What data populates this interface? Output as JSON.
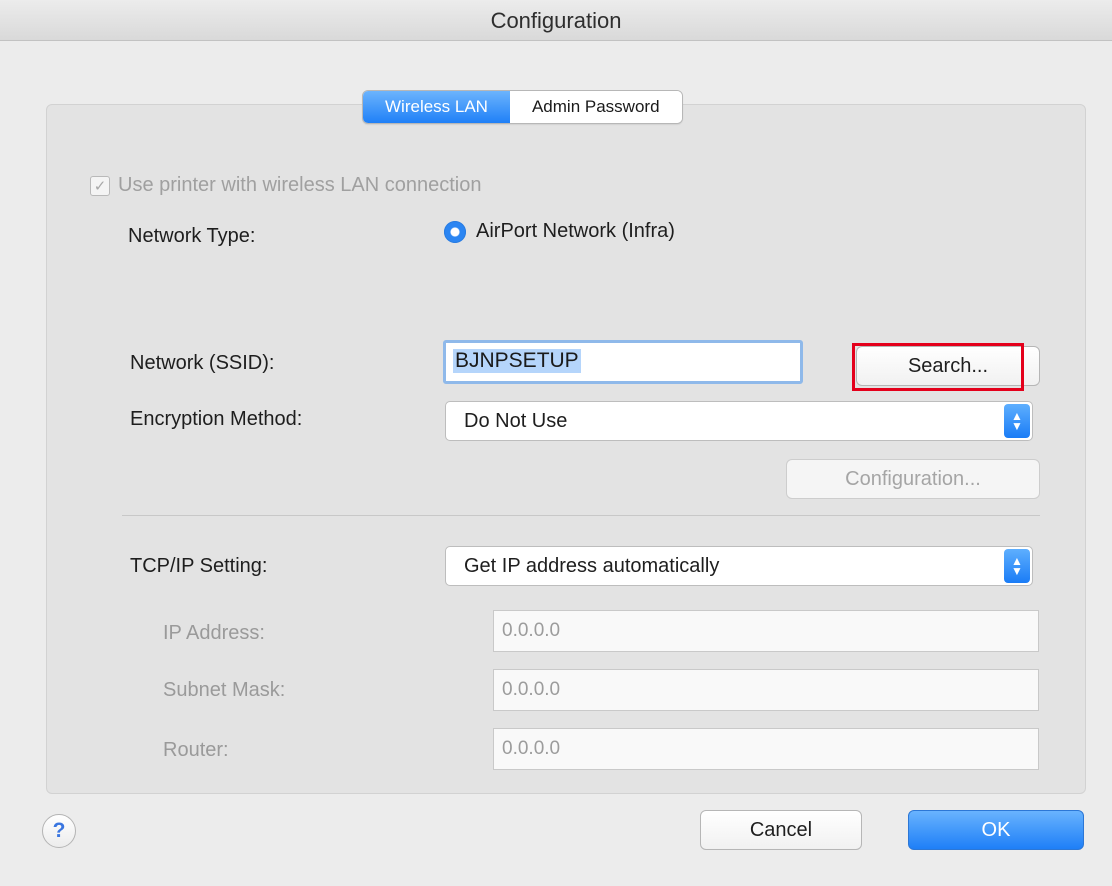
{
  "window": {
    "title": "Configuration"
  },
  "tabs": [
    {
      "label": "Wireless LAN",
      "active": true
    },
    {
      "label": "Admin Password",
      "active": false
    }
  ],
  "wireless": {
    "use_wireless_label": "Use printer with wireless LAN connection",
    "use_wireless_checked": true,
    "network_type_label": "Network Type:",
    "network_type_option": "AirPort Network (Infra)",
    "ssid_label": "Network (SSID):",
    "ssid_value": "BJNPSETUP",
    "search_button": "Search...",
    "encryption_label": "Encryption Method:",
    "encryption_value": "Do Not Use",
    "configuration_button": "Configuration..."
  },
  "tcpip": {
    "label": "TCP/IP Setting:",
    "value": "Get IP address automatically",
    "ip_label": "IP Address:",
    "ip_value": "0.0.0.0",
    "subnet_label": "Subnet Mask:",
    "subnet_value": "0.0.0.0",
    "router_label": "Router:",
    "router_value": "0.0.0.0"
  },
  "footer": {
    "help": "?",
    "cancel": "Cancel",
    "ok": "OK"
  },
  "colors": {
    "accent": "#1f80f7",
    "highlight": "#e4001b"
  }
}
